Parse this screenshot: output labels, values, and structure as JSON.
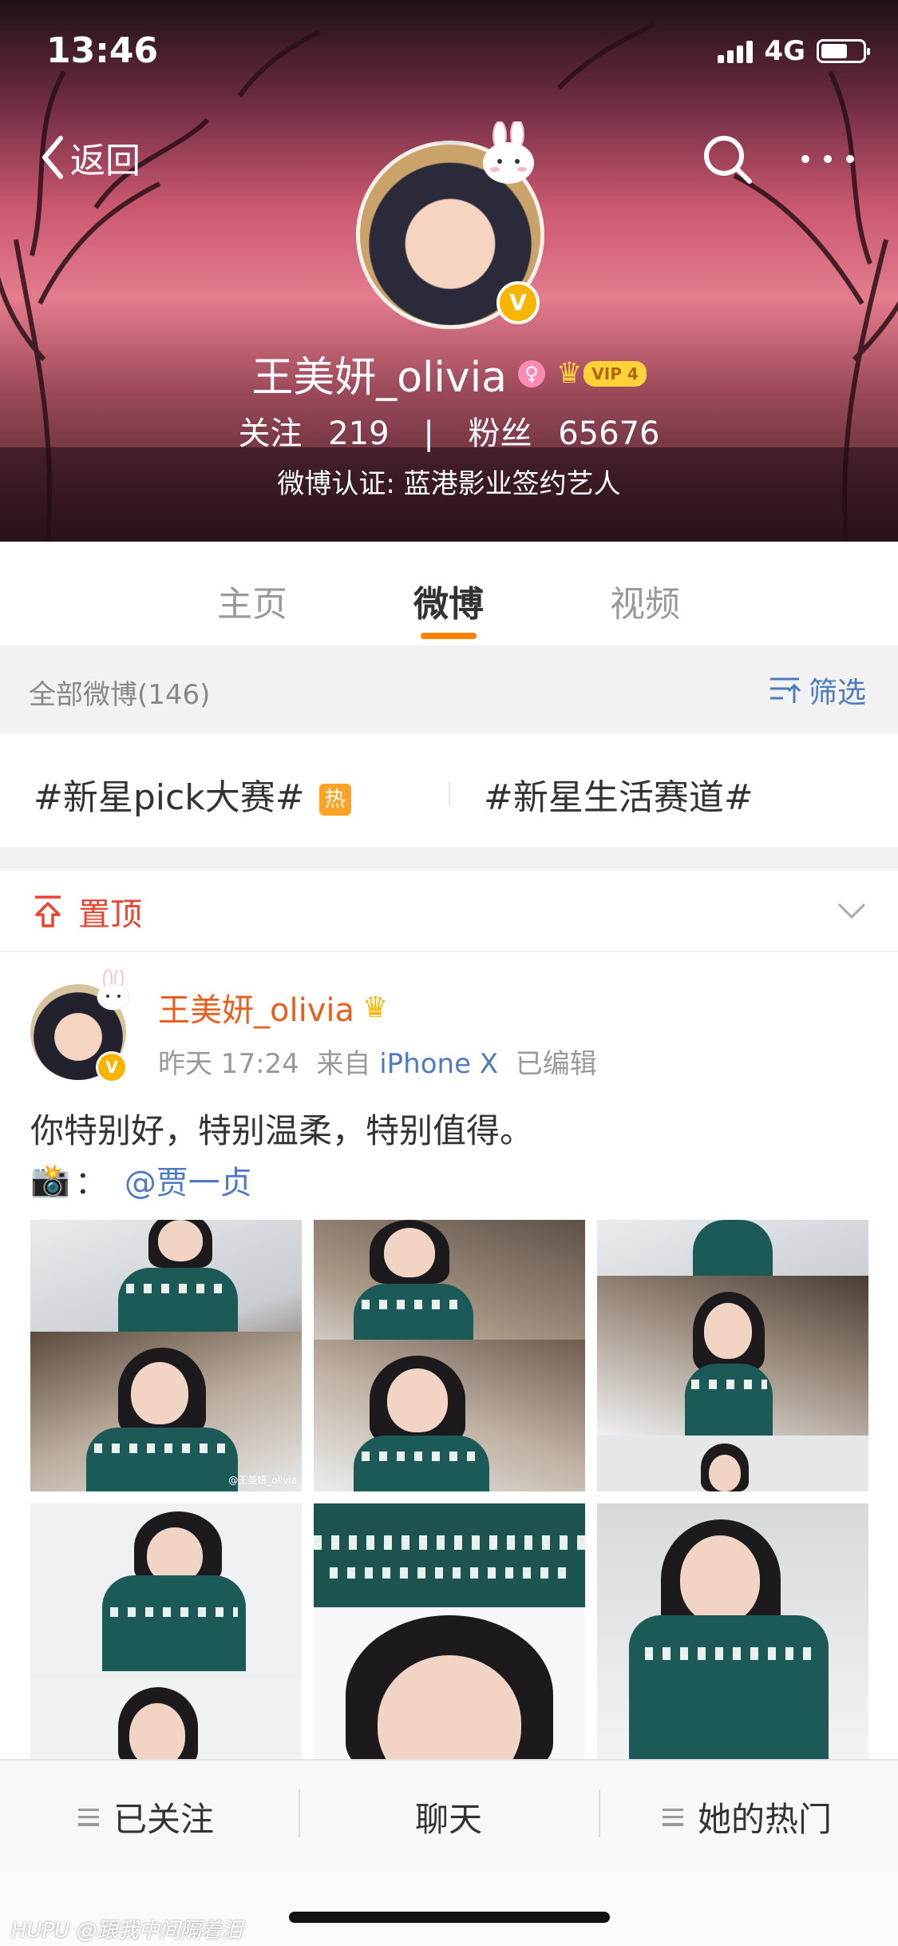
{
  "status_bar": {
    "time": "13:46",
    "network": "4G"
  },
  "nav": {
    "back_label": "返回"
  },
  "profile": {
    "name": "王美妍_olivia",
    "vip_label": "VIP 4",
    "verified_badge": "V",
    "following_label": "关注",
    "following_count": "219",
    "separator": "|",
    "fans_label": "粉丝",
    "fans_count": "65676",
    "verification": "微博认证: 蓝港影业签约艺人"
  },
  "tabs": [
    {
      "label": "主页",
      "active": false
    },
    {
      "label": "微博",
      "active": true
    },
    {
      "label": "视频",
      "active": false
    }
  ],
  "filter_bar": {
    "count_label": "全部微博(146)",
    "filter_label": "筛选"
  },
  "topics": [
    {
      "label": "#新星pick大赛#",
      "badge": "热"
    },
    {
      "label": "#新星生活赛道#"
    }
  ],
  "pinned": {
    "label": "置顶"
  },
  "post": {
    "author": "王美妍_olivia",
    "time": "昨天 17:24",
    "from_label": "来自",
    "source": "iPhone X",
    "edited": "已编辑",
    "text": "你特别好，特别温柔，特别值得。",
    "camera_emoji": "📸",
    "colon": "：",
    "mention": "@贾一贞",
    "watermark": "@王美妍_olivia"
  },
  "bottom_bar": {
    "followed_label": "已关注",
    "chat_label": "聊天",
    "hot_label": "她的热门"
  },
  "footer_credit": "HUPU @跟我中间隔着泪",
  "colors": {
    "accent_orange": "#ff8200",
    "link_blue": "#4e7bbf",
    "pinned_red": "#e8442e",
    "name_orange": "#e8601e"
  }
}
